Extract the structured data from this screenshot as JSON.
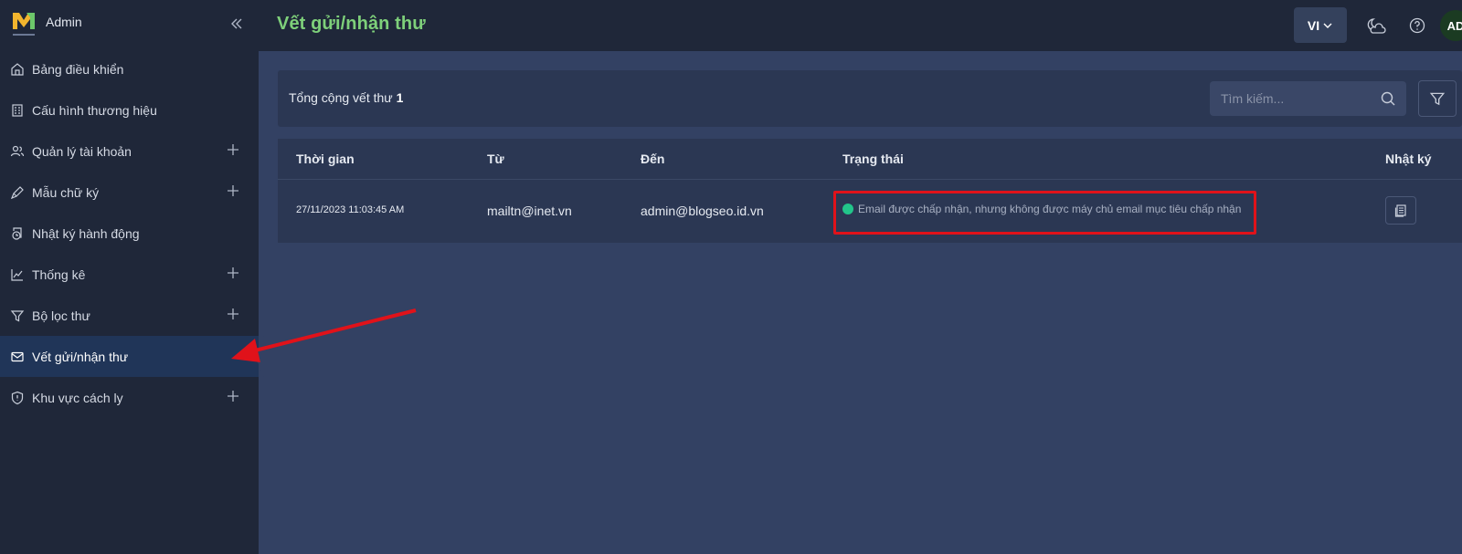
{
  "app": {
    "brand_name": "Admin",
    "page_title": "Vết gửi/nhận thư",
    "language": "VI",
    "avatar_initials": "AD"
  },
  "sidebar": {
    "items": [
      {
        "label": "Bảng điều khiển",
        "icon": "home-icon",
        "expandable": false,
        "active": false
      },
      {
        "label": "Cấu hình thương hiệu",
        "icon": "building-icon",
        "expandable": false,
        "active": false
      },
      {
        "label": "Quản lý tài khoản",
        "icon": "users-icon",
        "expandable": true,
        "active": false
      },
      {
        "label": "Mẫu chữ ký",
        "icon": "pen-icon",
        "expandable": true,
        "active": false
      },
      {
        "label": "Nhật ký hành động",
        "icon": "activity-log-icon",
        "expandable": false,
        "active": false
      },
      {
        "label": "Thống kê",
        "icon": "chart-icon",
        "expandable": true,
        "active": false
      },
      {
        "label": "Bộ lọc thư",
        "icon": "filter-icon",
        "expandable": true,
        "active": false
      },
      {
        "label": "Vết gửi/nhận thư",
        "icon": "mail-check-icon",
        "expandable": false,
        "active": true
      },
      {
        "label": "Khu vực cách ly",
        "icon": "shield-icon",
        "expandable": true,
        "active": false
      }
    ]
  },
  "summary": {
    "label": "Tổng cộng vết thư",
    "count": "1",
    "search_placeholder": "Tìm kiếm..."
  },
  "table": {
    "columns": [
      "Thời gian",
      "Từ",
      "Đến",
      "Trạng thái",
      "Nhật ký"
    ],
    "rows": [
      {
        "time": "27/11/2023 11:03:45 AM",
        "from": "mailtn@inet.vn",
        "to": "admin@blogseo.id.vn",
        "status": "Email được chấp nhận, nhưng không được máy chủ email mục tiêu chấp nhận",
        "status_color": "#22c58a"
      }
    ]
  },
  "colors": {
    "sidebar_bg": "#1f2739",
    "content_bg": "#334163",
    "title_accent": "#7ed07a",
    "highlight_annotation": "#e0121a"
  }
}
